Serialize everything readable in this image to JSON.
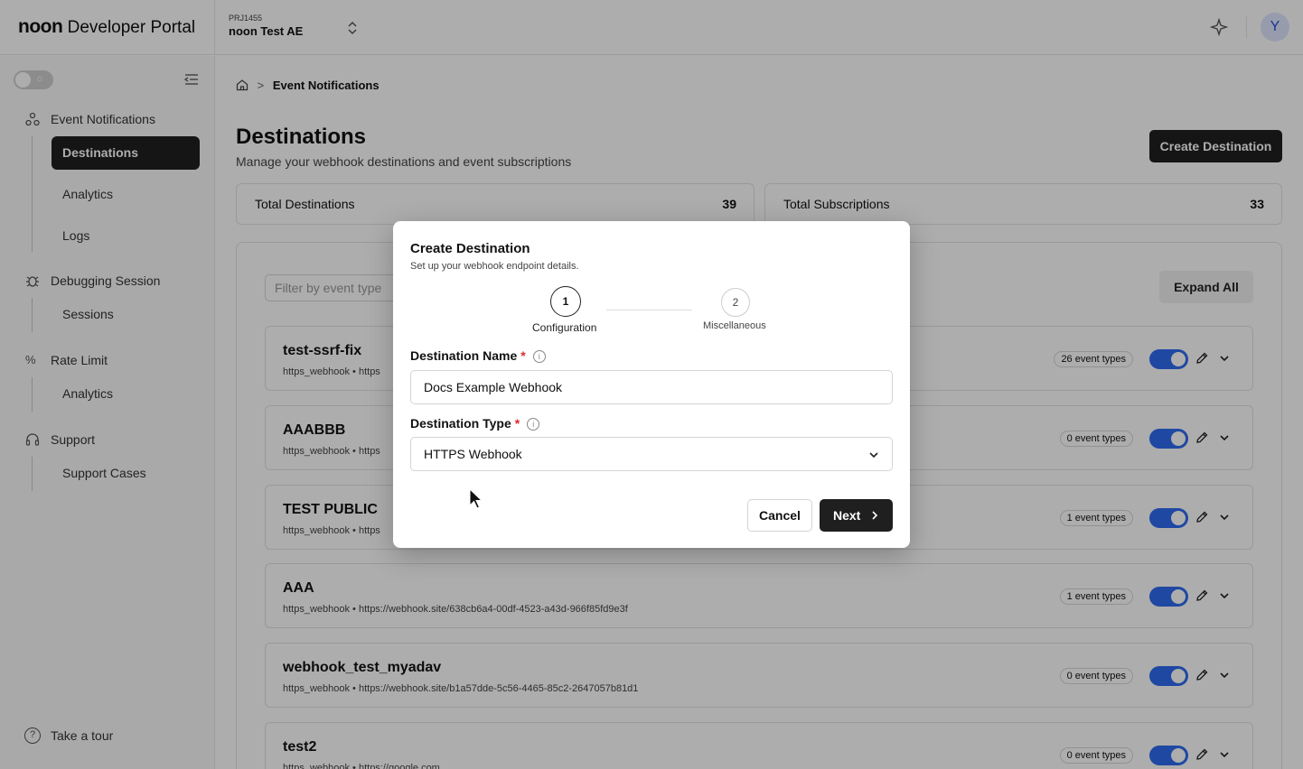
{
  "header": {
    "brand": "noon",
    "portal": "Developer Portal",
    "project_id": "PRJ1455",
    "project_name": "noon Test AE",
    "avatar_initial": "Y"
  },
  "sidebar": {
    "groups": [
      {
        "label": "Event Notifications",
        "icon": "webhook-icon",
        "items": [
          "Destinations",
          "Analytics",
          "Logs"
        ]
      },
      {
        "label": "Debugging Session",
        "icon": "bug-icon",
        "items": [
          "Sessions"
        ]
      },
      {
        "label": "Rate Limit",
        "icon": "percent-icon",
        "items": [
          "Analytics"
        ]
      },
      {
        "label": "Support",
        "icon": "headset-icon",
        "items": [
          "Support Cases"
        ]
      }
    ],
    "active_item": "Destinations",
    "tour_label": "Take a tour"
  },
  "breadcrumb": {
    "current": "Event Notifications"
  },
  "page": {
    "title": "Destinations",
    "subtitle": "Manage your webhook destinations and event subscriptions",
    "create_button": "Create Destination"
  },
  "stats": [
    {
      "label": "Total Destinations",
      "value": "39"
    },
    {
      "label": "Total Subscriptions",
      "value": "33"
    }
  ],
  "filter": {
    "placeholder": "Filter by event type"
  },
  "expand_all": "Expand All",
  "destinations": [
    {
      "name": "test-ssrf-fix",
      "url": "https_webhook • https",
      "events": "26 event types",
      "enabled": true
    },
    {
      "name": "AAABBB",
      "url": "https_webhook • https",
      "events": "0 event types",
      "enabled": true
    },
    {
      "name": "TEST PUBLIC",
      "url": "https_webhook • https",
      "events": "1 event types",
      "enabled": true
    },
    {
      "name": "AAA",
      "url": "https_webhook • https://webhook.site/638cb6a4-00df-4523-a43d-966f85fd9e3f",
      "events": "1 event types",
      "enabled": true
    },
    {
      "name": "webhook_test_myadav",
      "url": "https_webhook • https://webhook.site/b1a57dde-5c56-4465-85c2-2647057b81d1",
      "events": "0 event types",
      "enabled": true
    },
    {
      "name": "test2",
      "url": "https_webhook • https://google.com",
      "events": "0 event types",
      "enabled": true
    }
  ],
  "modal": {
    "title": "Create Destination",
    "subtitle": "Set up your webhook endpoint details.",
    "steps": [
      {
        "number": "1",
        "label": "Configuration"
      },
      {
        "number": "2",
        "label": "Miscellaneous"
      }
    ],
    "name_label": "Destination Name",
    "name_value": "Docs Example Webhook",
    "type_label": "Destination Type",
    "type_value": "HTTPS Webhook",
    "required_mark": "*",
    "cancel": "Cancel",
    "next": "Next"
  },
  "colors": {
    "primary_dark": "#1f1f1f",
    "toggle_on": "#2f6bf0",
    "required": "#e0282e"
  }
}
